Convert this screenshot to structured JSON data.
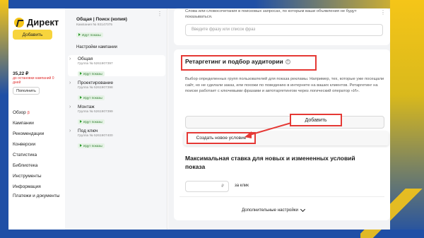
{
  "app": {
    "logo_text": "Директ",
    "add_button": "Добавить",
    "balance": "35,22 ₽",
    "balance_note": "до остановки кампаний 0 дней",
    "topup_button": "Пополнить"
  },
  "nav": {
    "items": [
      {
        "label": "Обзор",
        "badge": "β"
      },
      {
        "label": "Кампании"
      },
      {
        "label": "Рекомендации"
      },
      {
        "label": "Конверсии"
      },
      {
        "label": "Статистика"
      },
      {
        "label": "Библиотека"
      },
      {
        "label": "Инструменты"
      },
      {
        "label": "Информация"
      },
      {
        "label": "Платежи и документы"
      }
    ]
  },
  "tree": {
    "campaign": {
      "title": "Общая | Поиск (копия)",
      "sub": "Кампания № 93147075",
      "status": "Идут показы"
    },
    "settings_label": "Настройки кампании",
    "groups": [
      {
        "name": "Общая",
        "sub": "Группа № 5261907397",
        "status": "Идут показы"
      },
      {
        "name": "Проектирование",
        "sub": "Группа № 5261907398",
        "status": "Идут показы"
      },
      {
        "name": "Монтаж",
        "sub": "Группа № 5261907399",
        "status": "Идут показы"
      },
      {
        "name": "Под ключ",
        "sub": "Группа № 5261907400",
        "status": "Идут показы"
      }
    ]
  },
  "main": {
    "negative_text": "Слова или словосочетания в поисковых запросах, по которым ваши объявления не будут показываться.",
    "negative_placeholder": "Введите фразу или список фраз",
    "retargeting_title": "Ретаргетинг и подбор аудитории",
    "retargeting_help": "?",
    "retargeting_desc": "Выбор определенных групп пользователей для показа рекламы. Например, тех, которые уже посещали сайт, но не сделали заказ, или похожи по поведению в интернете на ваших клиентов. Ретаргетинг на поиске работает с ключевыми фразами и автотаргетингом через логический оператор «И».",
    "add_button": "Добавить",
    "dropdown_item": "Создать новое условие",
    "bid_title": "Максимальная ставка для новых и измененных условий показа",
    "bid_currency": "₽",
    "bid_per": "за клик",
    "more_settings": "Дополнительные настройки"
  },
  "colors": {
    "accent_yellow": "#f7d43d",
    "highlight_red": "#e53935",
    "frame_blue": "#1f4fa6",
    "status_green": "#2a7a2a"
  }
}
